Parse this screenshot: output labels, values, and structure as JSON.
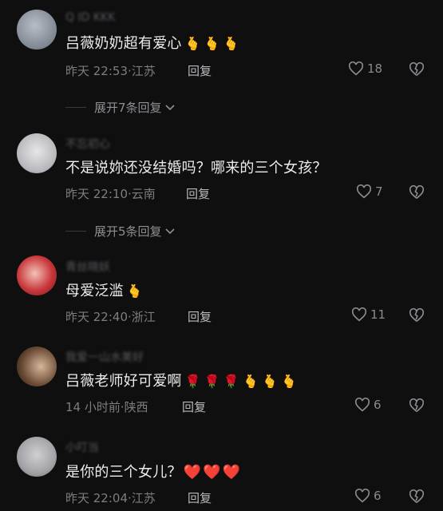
{
  "comments": [
    {
      "username": "Q ID KKK",
      "text": "吕薇奶奶超有爱心",
      "emojis": [
        "🫰",
        "🫰",
        "🫰"
      ],
      "time": "昨天 22:53",
      "location": "江苏",
      "reply_label": "回复",
      "likes": "18",
      "expand_label": "展开7条回复"
    },
    {
      "username": "不忘初心",
      "text": "不是说妳还没结婚吗？哪来的三个女孩？",
      "emojis": [],
      "time": "昨天 22:10",
      "location": "云南",
      "reply_label": "回复",
      "likes": "7",
      "expand_label": "展开5条回复"
    },
    {
      "username": "青丝晓妖",
      "text": "母爱泛滥",
      "emojis": [
        "🫰"
      ],
      "time": "昨天 22:40",
      "location": "浙江",
      "reply_label": "回复",
      "likes": "11"
    },
    {
      "username": "我爱一山水美好",
      "text": "吕薇老师好可爱啊",
      "emojis": [
        "🌹",
        "🌹",
        "🌹",
        "🫰",
        "🫰",
        "🫰"
      ],
      "time": "14 小时前",
      "location": "陕西",
      "reply_label": "回复",
      "likes": "6"
    },
    {
      "username": "小叮当",
      "text": "是你的三个女儿？",
      "emojis": [
        "❤️",
        "❤️",
        "❤️"
      ],
      "time": "昨天 22:04",
      "location": "江苏",
      "reply_label": "回复",
      "likes": "6"
    }
  ],
  "colors": {
    "background": "#0f0f10",
    "heart_red": "#e8353c"
  }
}
